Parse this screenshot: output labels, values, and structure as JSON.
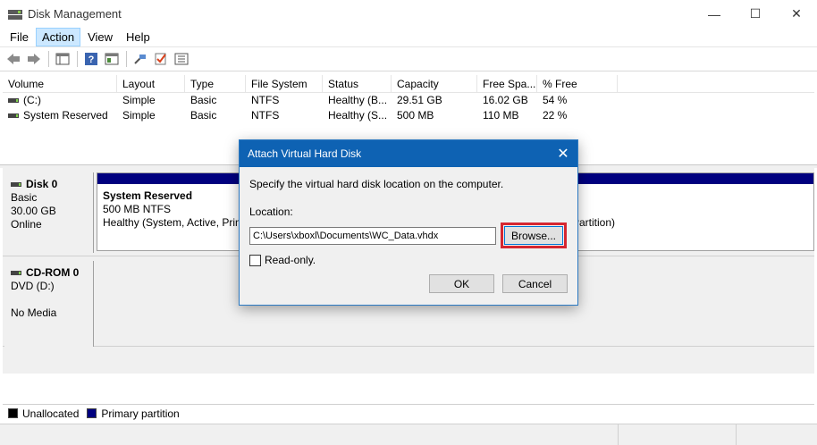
{
  "window": {
    "title": "Disk Management",
    "minimize_glyph": "—",
    "maximize_glyph": "☐",
    "close_glyph": "✕"
  },
  "menu": {
    "items": [
      "File",
      "Action",
      "View",
      "Help"
    ]
  },
  "toolbar": {
    "icons": [
      "back-arrow-icon",
      "forward-arrow-icon",
      "console-tree-icon",
      "help-icon",
      "properties-icon",
      "connect-icon",
      "check-icon",
      "list-icon"
    ]
  },
  "volume_list": {
    "columns": [
      "Volume",
      "Layout",
      "Type",
      "File System",
      "Status",
      "Capacity",
      "Free Spa...",
      "% Free"
    ],
    "rows": [
      [
        "(C:)",
        "Simple",
        "Basic",
        "NTFS",
        "Healthy (B...",
        "29.51 GB",
        "16.02 GB",
        "54 %"
      ],
      [
        "System Reserved",
        "Simple",
        "Basic",
        "NTFS",
        "Healthy (S...",
        "500 MB",
        "110 MB",
        "22 %"
      ]
    ]
  },
  "disks": [
    {
      "name": "Disk 0",
      "line1": "Basic",
      "line2": "30.00 GB",
      "line3": "Online",
      "partition": {
        "name": "System Reserved",
        "size": "500 MB NTFS",
        "status": "Healthy (System, Active, Prim",
        "second_status": "ary Partition)"
      }
    },
    {
      "name": "CD-ROM 0",
      "line1": "DVD (D:)",
      "line2": "",
      "line3": "No Media"
    }
  ],
  "legend": {
    "unallocated": "Unallocated",
    "primary": "Primary partition",
    "unallocated_color": "#000000",
    "primary_color": "#00007f"
  },
  "dialog": {
    "title": "Attach Virtual Hard Disk",
    "close_glyph": "✕",
    "description": "Specify the virtual hard disk location on the computer.",
    "location_label": "Location:",
    "location_value": "C:\\Users\\xboxl\\Documents\\WC_Data.vhdx",
    "browse_label": "Browse...",
    "readonly_label": "Read-only.",
    "ok_label": "OK",
    "cancel_label": "Cancel",
    "title_color": "#0e62b3",
    "highlight_color": "#d52630"
  }
}
